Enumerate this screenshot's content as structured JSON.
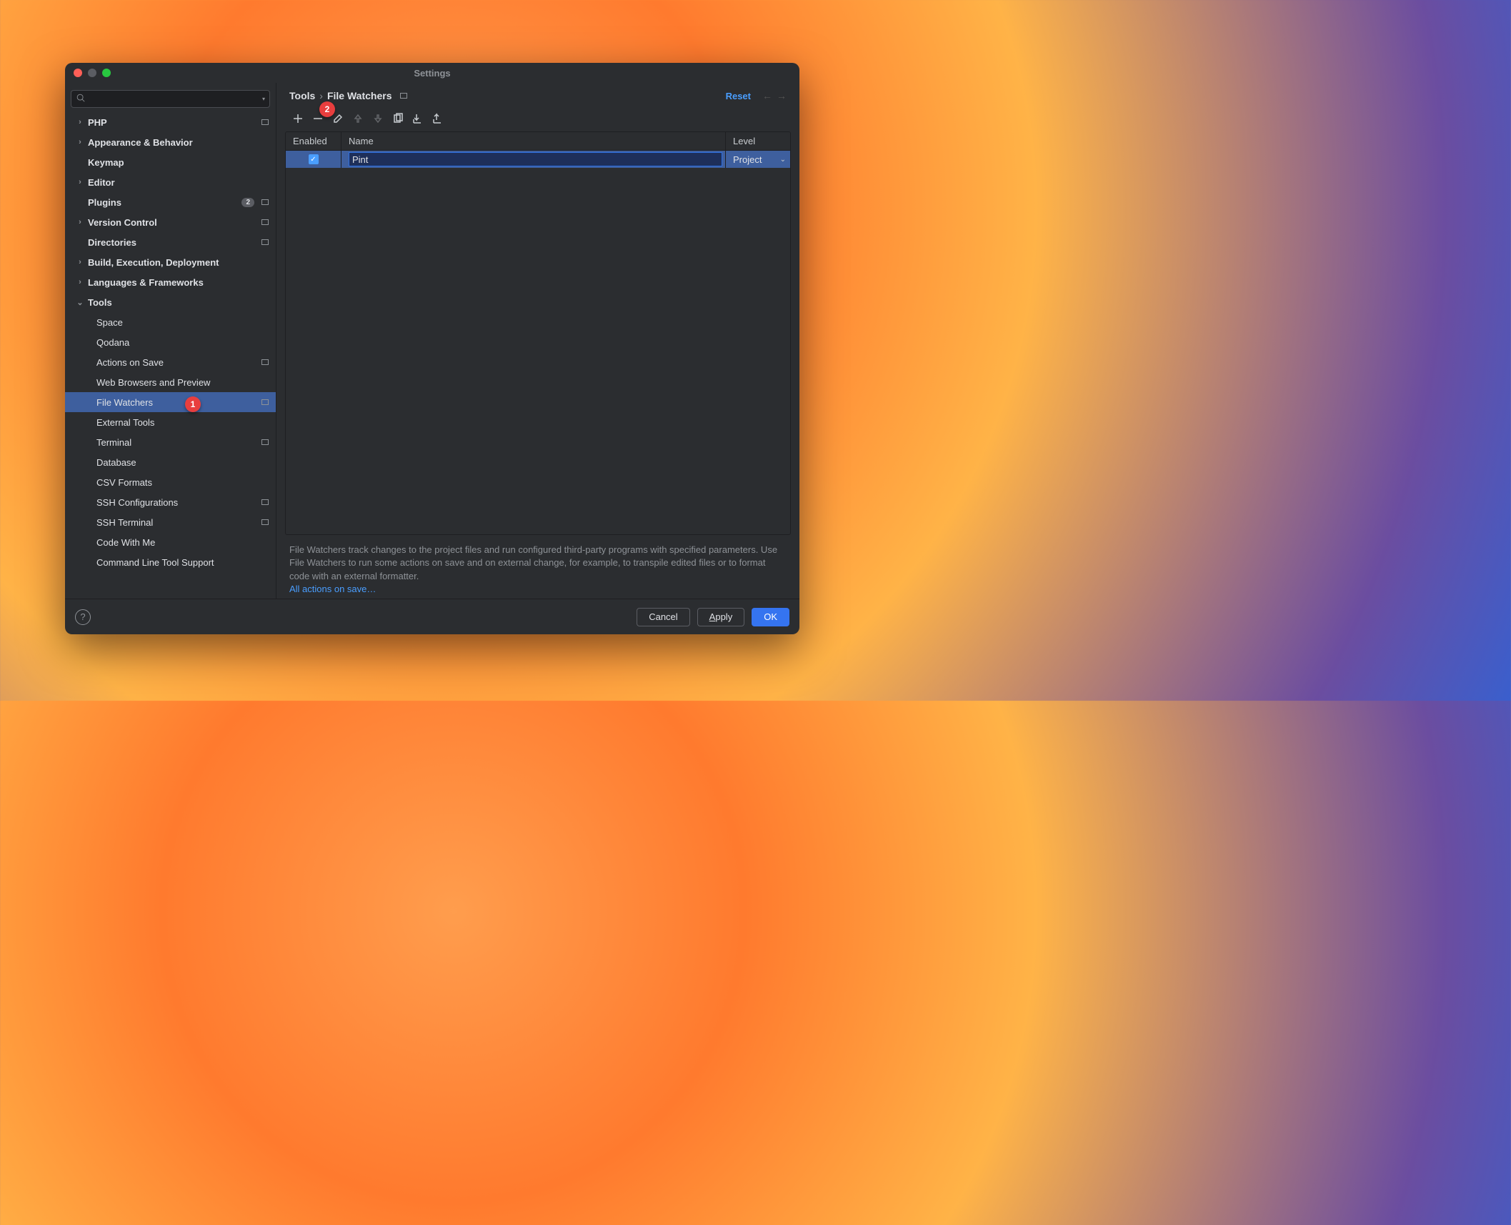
{
  "window": {
    "title": "Settings"
  },
  "search": {
    "placeholder": ""
  },
  "sidebar": [
    {
      "label": "PHP",
      "level": 0,
      "expandable": true,
      "proj": true
    },
    {
      "label": "Appearance & Behavior",
      "level": 0,
      "expandable": true
    },
    {
      "label": "Keymap",
      "level": 0,
      "expandable": false
    },
    {
      "label": "Editor",
      "level": 0,
      "expandable": true
    },
    {
      "label": "Plugins",
      "level": 0,
      "expandable": false,
      "badge": "2",
      "proj": true
    },
    {
      "label": "Version Control",
      "level": 0,
      "expandable": true,
      "proj": true
    },
    {
      "label": "Directories",
      "level": 0,
      "expandable": false,
      "proj": true
    },
    {
      "label": "Build, Execution, Deployment",
      "level": 0,
      "expandable": true
    },
    {
      "label": "Languages & Frameworks",
      "level": 0,
      "expandable": true
    },
    {
      "label": "Tools",
      "level": 0,
      "expandable": true,
      "expanded": true
    },
    {
      "label": "Space",
      "level": 1
    },
    {
      "label": "Qodana",
      "level": 1
    },
    {
      "label": "Actions on Save",
      "level": 1,
      "proj": true
    },
    {
      "label": "Web Browsers and Preview",
      "level": 1
    },
    {
      "label": "File Watchers",
      "level": 1,
      "proj": true,
      "selected": true
    },
    {
      "label": "External Tools",
      "level": 1
    },
    {
      "label": "Terminal",
      "level": 1,
      "proj": true
    },
    {
      "label": "Database",
      "level": 1,
      "expandable": true
    },
    {
      "label": "CSV Formats",
      "level": 1
    },
    {
      "label": "SSH Configurations",
      "level": 1,
      "proj": true
    },
    {
      "label": "SSH Terminal",
      "level": 1,
      "proj": true
    },
    {
      "label": "Code With Me",
      "level": 1
    },
    {
      "label": "Command Line Tool Support",
      "level": 1
    }
  ],
  "breadcrumb": {
    "root": "Tools",
    "leaf": "File Watchers"
  },
  "reset_label": "Reset",
  "table": {
    "columns": {
      "enabled": "Enabled",
      "name": "Name",
      "level": "Level"
    },
    "rows": [
      {
        "enabled": true,
        "name": "Pint",
        "level": "Project"
      }
    ]
  },
  "hint": {
    "text": "File Watchers track changes to the project files and run configured third-party programs with specified parameters. Use File Watchers to run some actions on save and on external change, for example, to transpile edited files or to format code with an external formatter.",
    "link": "All actions on save…"
  },
  "buttons": {
    "cancel": "Cancel",
    "apply": "Apply",
    "apply_mnemonic": "A",
    "apply_rest": "pply",
    "ok": "OK"
  },
  "annotations": {
    "one": "1",
    "two": "2"
  }
}
